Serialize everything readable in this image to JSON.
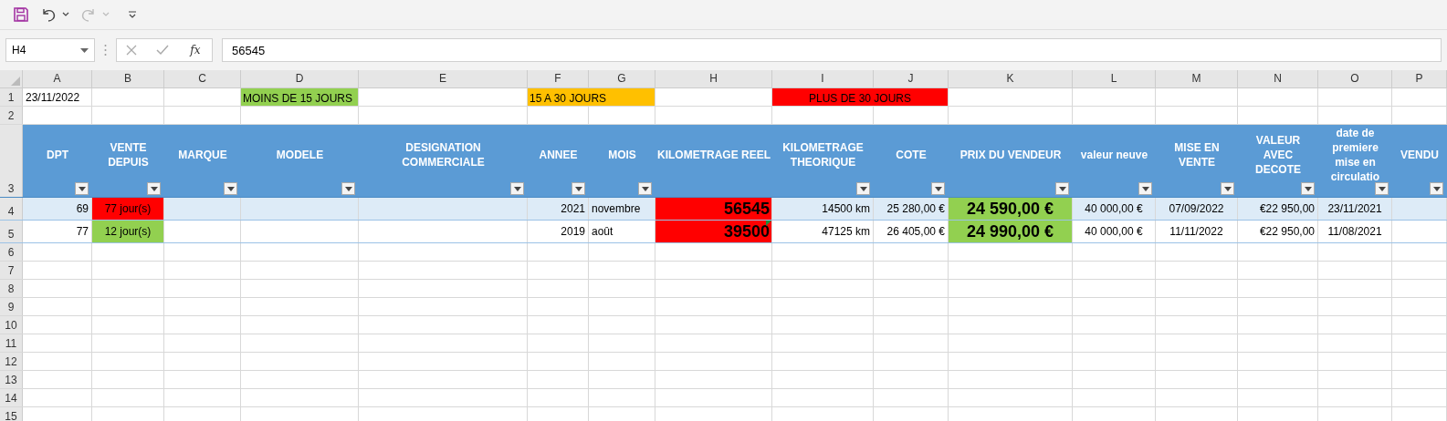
{
  "toolbar": {
    "redo_disabled": true
  },
  "formula_bar": {
    "name_box": "H4",
    "cancel_disabled": true,
    "enter_disabled": true,
    "fx": "fx",
    "value": "56545"
  },
  "columns": [
    "A",
    "B",
    "C",
    "D",
    "E",
    "F",
    "G",
    "H",
    "I",
    "J",
    "K",
    "L",
    "M",
    "N",
    "O",
    "P"
  ],
  "rows": [
    {
      "number": "1",
      "kind": "plain",
      "cells": [
        {
          "text": "23/11/2022",
          "kind": "label"
        },
        {},
        {},
        {
          "text": "MOINS DE 15 JOURS",
          "kind": "label",
          "color": "#92d050"
        },
        {},
        {
          "text": "15 A 30 JOURS",
          "kind": "label",
          "color": "#ffc000"
        },
        {
          "color": "#ffc000"
        },
        {},
        {
          "text": "PLUS DE 30 JOURS",
          "kind": "center",
          "color": "#ff0000"
        },
        {
          "color": "#ff0000"
        },
        {},
        {},
        {},
        {},
        {}
      ]
    },
    {
      "number": "2",
      "kind": "plain"
    },
    {
      "number": "3",
      "kind": "header",
      "cells": [
        {
          "lines": [
            "DPT"
          ],
          "filter": true
        },
        {
          "lines": [
            "VENTE",
            "DEPUIS"
          ],
          "filter": true
        },
        {
          "lines": [
            "MARQUE"
          ],
          "filter": true
        },
        {
          "lines": [
            "MODELE"
          ],
          "filter": true
        },
        {
          "lines": [
            "DESIGNATION",
            "COMMERCIALE"
          ],
          "filter": true
        },
        {
          "lines": [
            "ANNEE"
          ],
          "filter": true
        },
        {
          "lines": [
            "MOIS"
          ],
          "filter": true
        },
        {
          "lines": [
            "KILOMETRAGE REEL"
          ],
          "filter": false
        },
        {
          "lines": [
            "KILOMETRAGE",
            "THEORIQUE"
          ],
          "filter": true
        },
        {
          "lines": [
            "COTE"
          ],
          "filter": true
        },
        {
          "lines": [
            "PRIX DU VENDEUR"
          ],
          "filter": true
        },
        {
          "lines": [
            "valeur neuve"
          ],
          "filter": true
        },
        {
          "lines": [
            "MISE EN",
            "VENTE"
          ],
          "filter": true
        },
        {
          "lines": [
            "VALEUR",
            "AVEC",
            "DECOTE"
          ],
          "filter": true
        },
        {
          "lines": [
            "date de",
            "premiere",
            "mise en",
            "circulatio"
          ],
          "filter": true
        },
        {
          "lines": [
            "VENDU"
          ],
          "filter": true
        }
      ]
    },
    {
      "number": "4",
      "kind": "band",
      "cells": [
        {
          "text": "69",
          "kind": "number"
        },
        {
          "text": "77  jour(s)",
          "kind": "center",
          "color": "#ff0000"
        },
        {},
        {},
        {},
        {
          "text": "2021",
          "kind": "number"
        },
        {
          "text": "novembre",
          "kind": "label"
        },
        {
          "text": "56545",
          "kind": "big",
          "color": "#ff0000"
        },
        {
          "text": "14500 km",
          "kind": "number"
        },
        {
          "text": "25 280,00 €",
          "kind": "number"
        },
        {
          "text": "24 590,00 €",
          "kind": "bigcenter",
          "color": "#92d050"
        },
        {
          "text": "40 000,00 €",
          "kind": "center"
        },
        {
          "text": "07/09/2022",
          "kind": "center"
        },
        {
          "text": "€22 950,00",
          "kind": "number"
        },
        {
          "text": "23/11/2021",
          "kind": "center"
        },
        {}
      ]
    },
    {
      "number": "5",
      "kind": "table",
      "cells": [
        {
          "text": "77",
          "kind": "number"
        },
        {
          "text": "12  jour(s)",
          "kind": "center",
          "color": "#92d050"
        },
        {},
        {},
        {},
        {
          "text": "2019",
          "kind": "number"
        },
        {
          "text": "août",
          "kind": "label"
        },
        {
          "text": "39500",
          "kind": "big",
          "color": "#ff0000",
          "flag": true
        },
        {
          "text": "47125 km",
          "kind": "number"
        },
        {
          "text": "26 405,00 €",
          "kind": "number"
        },
        {
          "text": "24 990,00 €",
          "kind": "bigcenter",
          "color": "#92d050"
        },
        {
          "text": "40 000,00 €",
          "kind": "center"
        },
        {
          "text": "11/11/2022",
          "kind": "center"
        },
        {
          "text": "€22 950,00",
          "kind": "number"
        },
        {
          "text": "11/08/2021",
          "kind": "center"
        },
        {}
      ]
    },
    {
      "number": "6",
      "kind": "plain"
    },
    {
      "number": "7",
      "kind": "plain"
    },
    {
      "number": "8",
      "kind": "plain"
    },
    {
      "number": "9",
      "kind": "plain"
    },
    {
      "number": "10",
      "kind": "plain"
    },
    {
      "number": "11",
      "kind": "plain"
    },
    {
      "number": "12",
      "kind": "plain"
    },
    {
      "number": "13",
      "kind": "plain"
    },
    {
      "number": "14",
      "kind": "plain"
    },
    {
      "number": "15",
      "kind": "plain"
    }
  ]
}
